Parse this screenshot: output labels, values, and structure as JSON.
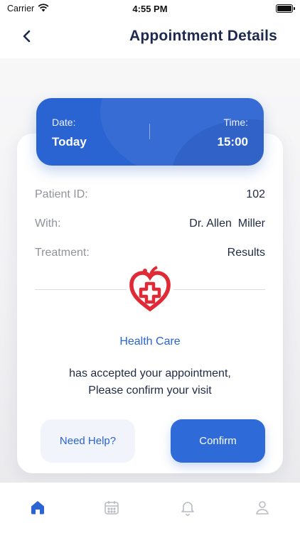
{
  "status_bar": {
    "carrier": "Carrier",
    "time": "4:55 PM"
  },
  "header": {
    "title": "Appointment Details",
    "back_icon": "chevron-left-icon"
  },
  "appointment": {
    "date_label": "Date:",
    "date_value": "Today",
    "time_label": "Time:",
    "time_value": "15:00"
  },
  "details": [
    {
      "label": "Patient ID:",
      "value": "102"
    },
    {
      "label": "With:",
      "value": "Dr. Allen  Miller"
    },
    {
      "label": "Treatment:",
      "value": "Results"
    }
  ],
  "provider": {
    "logo_icon": "heart-cross-icon",
    "name": "Health Care"
  },
  "message": {
    "line1": "has accepted your appointment,",
    "line2": "Please confirm your visit"
  },
  "actions": {
    "help_label": "Need Help?",
    "confirm_label": "Confirm"
  },
  "tab_bar": {
    "items": [
      {
        "icon": "home-icon",
        "active": true
      },
      {
        "icon": "calendar-icon",
        "active": false
      },
      {
        "icon": "bell-icon",
        "active": false
      },
      {
        "icon": "profile-icon",
        "active": false
      }
    ]
  },
  "colors": {
    "primary": "#2a63d2",
    "title": "#1d2a4d",
    "label_gray": "#8f939b",
    "logo_red": "#e02a35",
    "tab_inactive": "#b9bcc4"
  }
}
